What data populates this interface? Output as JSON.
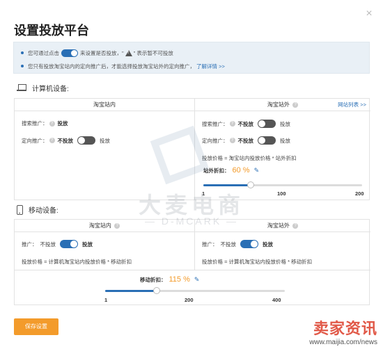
{
  "dialog": {
    "title": "设置投放平台",
    "close_icon": "×"
  },
  "notice": {
    "line1_before": "您可通过点击",
    "line1_mid": "来设置是否投放，\"",
    "line1_after": "\" 表示暂不可投放",
    "line2_text": "您只有投放淘宝站内的定向推广后，才能选择投放淘宝站外的定向推广，",
    "line2_link": "了解详情 >>"
  },
  "computer": {
    "heading": "计算机设备:",
    "inside": {
      "header": "淘宝站内",
      "search_label": "搜索推广：",
      "search_value": "投放",
      "targeted_label": "定向推广：",
      "targeted_off": "不投放",
      "targeted_on": "投放"
    },
    "outside": {
      "header": "淘宝站外",
      "site_list_link": "网站列表 >>",
      "search_label": "搜索推广：",
      "search_off": "不投放",
      "search_on": "投放",
      "targeted_label": "定向推广：",
      "targeted_off": "不投放",
      "targeted_on": "投放",
      "price_formula": "投放价格 = 淘宝站内投放价格 * 站外折扣",
      "discount_label": "站外折扣：",
      "discount_value": "60 %",
      "slider_value": 60,
      "slider_min": "1",
      "slider_mid": "100",
      "slider_max": "200"
    }
  },
  "mobile": {
    "heading": "移动设备:",
    "inside": {
      "header": "淘宝站内",
      "promo_label": "推广：",
      "promo_off": "不投放",
      "promo_on": "投放",
      "price_formula": "投放价格 = 计算机淘宝站内投放价格 * 移动折扣"
    },
    "outside": {
      "header": "淘宝站外",
      "promo_label": "推广：",
      "promo_off": "不投放",
      "promo_on": "投放",
      "price_formula": "投放价格 = 计算机淘宝站内投放价格 * 移动折扣"
    },
    "discount": {
      "label": "移动折扣：",
      "value": "115 %",
      "slider_value": 115,
      "slider_min": "1",
      "slider_mid": "200",
      "slider_max": "400"
    }
  },
  "buttons": {
    "save": "保存设置"
  },
  "watermark": {
    "cn": "大麦电商",
    "en": "— D-MCARK —"
  },
  "corner_mark": {
    "cn": "卖家资讯",
    "url": "www.maijia.com/news"
  },
  "colors": {
    "accent": "#2a6fb5",
    "orange": "#f39b2b",
    "toggle_off": "#555555"
  },
  "icons": {
    "close": "close-icon",
    "computer": "laptop-icon",
    "mobile": "phone-icon",
    "help": "question-icon",
    "edit": "pencil-icon",
    "warning": "warning-icon"
  }
}
